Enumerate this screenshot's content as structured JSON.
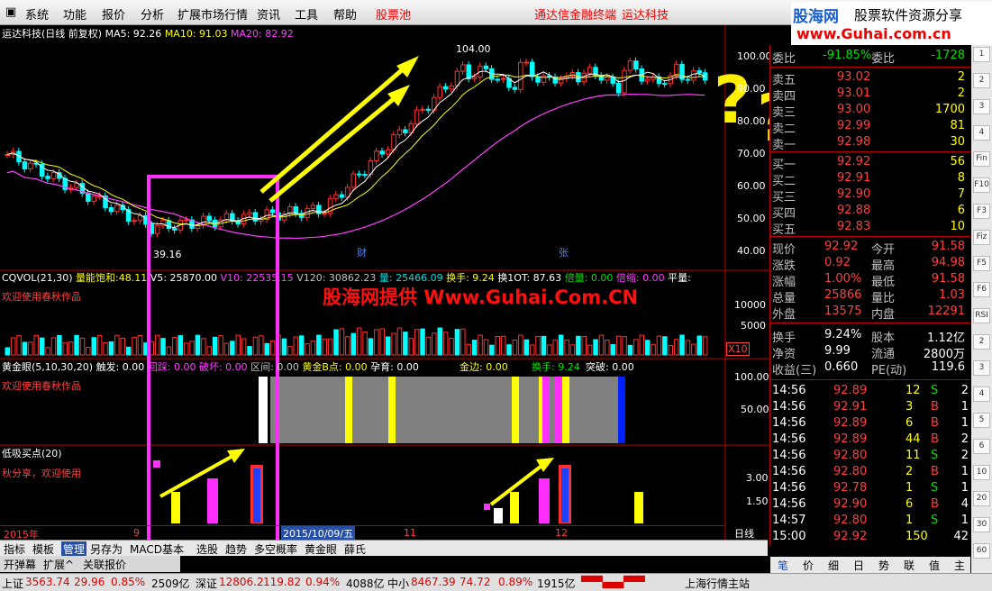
{
  "menu": {
    "items": [
      "系统",
      "功能",
      "报价",
      "分析",
      "扩展市场行情",
      "资讯",
      "工具",
      "帮助"
    ],
    "gupiao": "股票池",
    "center1": "通达信金融终端",
    "center2": "运达科技"
  },
  "logo": {
    "line1": "股海网",
    "line1b": "股票软件资源分享",
    "line2": "www.Guhai.com.cn"
  },
  "chart": {
    "title": "运达科技(日线 前复权)",
    "ma5": "MA5: 92.26",
    "ma10": "MA10: 91.03",
    "ma20": "MA20: 82.92",
    "high_label": "104.00",
    "low_label": "39.16",
    "cai": "财",
    "zhang": "张",
    "y_ticks": [
      "100.00",
      "90.00",
      "80.00",
      "70.00",
      "60.00",
      "50.00",
      "40.00"
    ],
    "x_labels": [
      "2015年",
      "9",
      "11",
      "12"
    ],
    "date_label": "2015/10/09/五",
    "period": "日线",
    "colors": {
      "up": "#ff3030",
      "down": "#00ffff",
      "ma5": "#ffffff",
      "ma10": "#ffff00",
      "ma20": "#ff40ff",
      "box": "#ff30ff",
      "arrow": "#ffff00"
    }
  },
  "vol": {
    "name": "CQVOL(21,30)",
    "energy_label": "量能饱和:",
    "energy_val": "48.11",
    "v5": "V5: 25870.00",
    "v10": "V10: 22535.15",
    "v120": "V120: 30862.23",
    "liang": "量: 25466.09",
    "huanshou": "换手: 9.24",
    "huan10t": "换1OT: 87.63",
    "beiliang": "倍量: 0.00",
    "beisuo": "倍缩: 0.00",
    "pingliang": "平量:",
    "author": "欢迎使用春秋作品",
    "watermark": "股海网提供 Www.Guhai.Com.CN",
    "y_ticks": [
      "10000",
      "5000"
    ],
    "x10": "X10"
  },
  "gold": {
    "name": "黄金眼(5,10,30,20)",
    "chufa": "触发: 0.00",
    "huicai": "回踩: 0.00",
    "pohuai": "破坏: 0.00",
    "xx": "区间: 0.00",
    "bpoint": "黄金B点: 0.00",
    "yunyu": "孕育: 0.00",
    "jinbian": "金边: 0.00",
    "huanshou": "换手: 9.24",
    "tupo": "突破: 0.00",
    "author": "欢迎使用春秋作品",
    "y_ticks": [
      "100.00",
      "50.00"
    ]
  },
  "low": {
    "name": "低吸买点(20)",
    "author": "秋分享，欢迎使用",
    "y_ticks": [
      "3.00",
      "1.50"
    ]
  },
  "quote": {
    "weibi_label": "委比",
    "weibi": "-91.85%",
    "weicha_label": "委差",
    "weicha": "-1728",
    "asks": [
      {
        "label": "卖五",
        "price": "93.02",
        "vol": "2"
      },
      {
        "label": "卖四",
        "price": "93.01",
        "vol": "2"
      },
      {
        "label": "卖三",
        "price": "93.00",
        "vol": "1700"
      },
      {
        "label": "卖二",
        "price": "92.99",
        "vol": "81"
      },
      {
        "label": "卖一",
        "price": "92.98",
        "vol": "30"
      }
    ],
    "bids": [
      {
        "label": "买一",
        "price": "92.92",
        "vol": "56"
      },
      {
        "label": "买二",
        "price": "92.91",
        "vol": "8"
      },
      {
        "label": "买三",
        "price": "92.90",
        "vol": "7"
      },
      {
        "label": "买四",
        "price": "92.88",
        "vol": "6"
      },
      {
        "label": "买五",
        "price": "92.83",
        "vol": "10"
      }
    ],
    "stats": [
      {
        "l1": "现价",
        "v1": "92.92",
        "l2": "今开",
        "v2": "91.58"
      },
      {
        "l1": "涨跌",
        "v1": "0.92",
        "l2": "最高",
        "v2": "94.98"
      },
      {
        "l1": "涨幅",
        "v1": "1.00%",
        "l2": "最低",
        "v2": "91.58"
      },
      {
        "l1": "总量",
        "v1": "25866",
        "l2": "量比",
        "v2": "1.03"
      },
      {
        "l1": "外盘",
        "v1": "13575",
        "l2": "内盘",
        "v2": "12291"
      }
    ],
    "stats2": [
      {
        "l1": "换手",
        "v1": "9.24%",
        "l2": "股本",
        "v2": "1.12亿"
      },
      {
        "l1": "净资",
        "v1": "9.99",
        "l2": "流通",
        "v2": "2800万"
      },
      {
        "l1": "收益(三)",
        "v1": "0.660",
        "l2": "PE(动)",
        "v2": "119.6"
      }
    ],
    "ticks": [
      {
        "t": "14:56",
        "p": "92.89",
        "v": "12",
        "d": "S",
        "n": "2"
      },
      {
        "t": "14:56",
        "p": "92.91",
        "v": "3",
        "d": "B",
        "n": "1"
      },
      {
        "t": "14:56",
        "p": "92.89",
        "v": "6",
        "d": "B",
        "n": "1"
      },
      {
        "t": "14:56",
        "p": "92.89",
        "v": "44",
        "d": "B",
        "n": "2"
      },
      {
        "t": "14:56",
        "p": "92.80",
        "v": "11",
        "d": "S",
        "n": "2"
      },
      {
        "t": "14:56",
        "p": "92.80",
        "v": "2",
        "d": "B",
        "n": "1"
      },
      {
        "t": "14:56",
        "p": "92.78",
        "v": "1",
        "d": "S",
        "n": "1"
      },
      {
        "t": "14:56",
        "p": "92.90",
        "v": "6",
        "d": "B",
        "n": "4"
      },
      {
        "t": "14:57",
        "p": "92.80",
        "v": "1",
        "d": "S",
        "n": "1"
      },
      {
        "t": "15:00",
        "p": "92.92",
        "v": "150",
        "d": "",
        "n": "42"
      }
    ],
    "tabs": [
      "笔",
      "价",
      "细",
      "日",
      "势",
      "联",
      "值",
      "主"
    ]
  },
  "side_icons": [
    "1",
    "2",
    "3",
    "4",
    "Fin",
    "F10",
    "F3",
    "Fiz",
    "F5",
    "F6",
    "RSI",
    "2",
    "3",
    "4",
    "5",
    "6",
    "10",
    "20",
    "30",
    "60"
  ],
  "tabs": [
    "指标",
    "模板",
    "管理",
    "另存为",
    "MACD基本",
    "选股",
    "趋势",
    "多空概率",
    "黄金眼",
    "薛氏"
  ],
  "sub": {
    "a": "开弹幕",
    "b": "扩展^",
    "c": "关联报价"
  },
  "status": {
    "sh_label": "上证",
    "sh": "3563.74",
    "sh_chg": "29.96",
    "sh_pct": "0.85%",
    "sh_amt": "2509亿",
    "sz_label": "深证",
    "sz": "12806.2",
    "sz_chg": "119.82",
    "sz_pct": "0.94%",
    "sz_amt": "4088亿",
    "zx_label": "中小",
    "zx": "8467.39",
    "zx_chg": "74.72",
    "zx_pct": "0.89%",
    "zx_amt": "1915亿",
    "server": "上海行情主站"
  }
}
